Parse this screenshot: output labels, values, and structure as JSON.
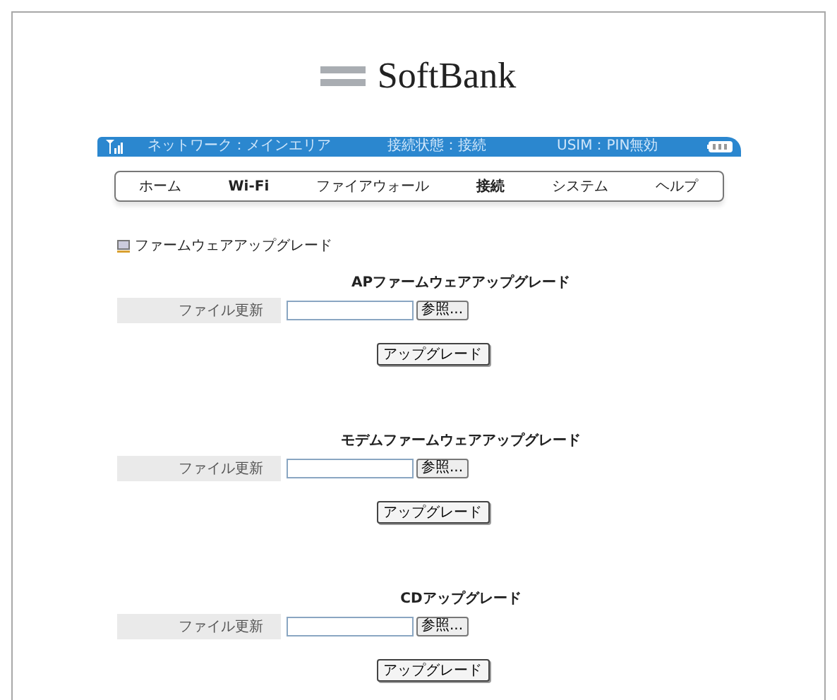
{
  "logo": {
    "text": "SoftBank"
  },
  "status_bar": {
    "network": "ネットワーク：メインエリア",
    "connection": "接続状態：接続",
    "usim": "USIM：PIN無効"
  },
  "nav": [
    {
      "label": "ホーム",
      "emphasized": false
    },
    {
      "label": "Wi-Fi",
      "emphasized": true
    },
    {
      "label": "ファイアウォール",
      "emphasized": false
    },
    {
      "label": "接続",
      "emphasized": true
    },
    {
      "label": "システム",
      "emphasized": false
    },
    {
      "label": "ヘルプ",
      "emphasized": false
    }
  ],
  "page_title": "ファームウェアアップグレード",
  "sections": [
    {
      "title": "APファームウェアアップグレード",
      "field_label": "ファイル更新",
      "browse": "参照...",
      "button": "アップグレード"
    },
    {
      "title": "モデムファームウェアアップグレード",
      "field_label": "ファイル更新",
      "browse": "参照...",
      "button": "アップグレード"
    },
    {
      "title": "CDアップグレード",
      "field_label": "ファイル更新",
      "browse": "参照...",
      "button": "アップグレード"
    }
  ]
}
